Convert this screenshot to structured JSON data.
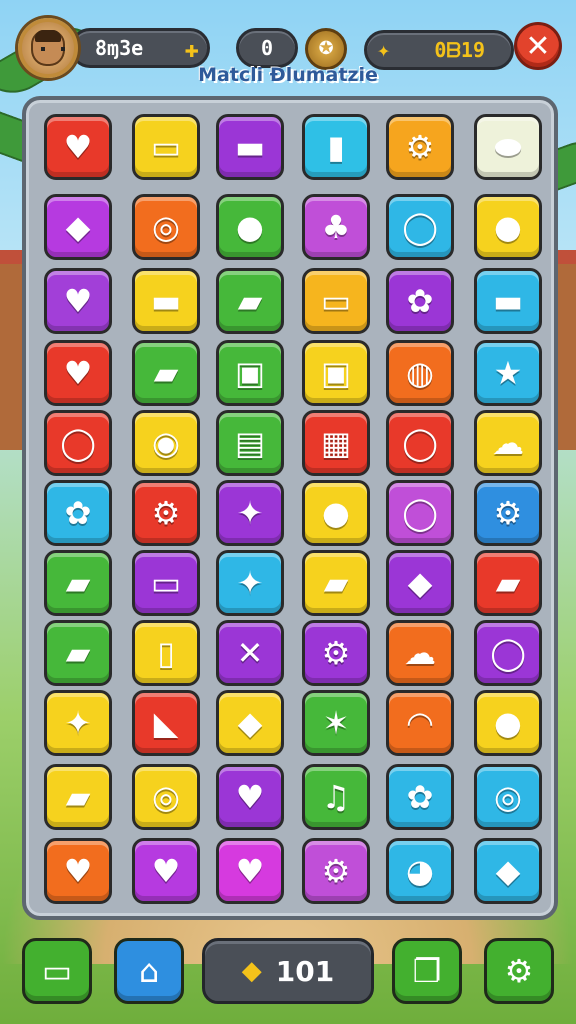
{
  "hud": {
    "player_name": "8ɱ3e",
    "plus_icon": "plus-icon",
    "score": "0",
    "coin_icon": "coin-icon",
    "best_score": "0ᗷ19",
    "medal_icon": "medal-icon",
    "close_icon": "close-icon",
    "title": "Matcli Ɖlumatzie"
  },
  "board": {
    "columns": 6,
    "rows": 11,
    "tiles": [
      {
        "color": "#e8392a",
        "sym": "♥",
        "icon": "heart-icon"
      },
      {
        "color": "#f6d21e",
        "sym": "▭",
        "icon": "card-icon"
      },
      {
        "color": "#9b36d6",
        "sym": "▬",
        "icon": "bar-icon"
      },
      {
        "color": "#2fc0e6",
        "sym": "▮",
        "icon": "capsule-icon"
      },
      {
        "color": "#f6a51e",
        "sym": "⚙",
        "icon": "gear-icon"
      },
      {
        "color": "#eef2da",
        "sym": "⬬",
        "icon": "leaf-icon"
      },
      {
        "color": "#b63ae0",
        "sym": "◆",
        "icon": "tag-icon"
      },
      {
        "color": "#f26d1e",
        "sym": "◎",
        "icon": "ring-icon"
      },
      {
        "color": "#46b83a",
        "sym": "●",
        "icon": "bulb-icon"
      },
      {
        "color": "#c04fd8",
        "sym": "♣",
        "icon": "clover-icon"
      },
      {
        "color": "#2fb7e6",
        "sym": "◯",
        "icon": "magnifier-icon"
      },
      {
        "color": "#f6d21e",
        "sym": "●",
        "icon": "fruit-icon"
      },
      {
        "color": "#a23fd8",
        "sym": "♥",
        "icon": "heart-icon"
      },
      {
        "color": "#f6d21e",
        "sym": "▬",
        "icon": "bar-icon"
      },
      {
        "color": "#46b83a",
        "sym": "▰",
        "icon": "crayon-icon"
      },
      {
        "color": "#f6b51e",
        "sym": "▭",
        "icon": "folder-icon"
      },
      {
        "color": "#9b36d6",
        "sym": "✿",
        "icon": "flower-icon"
      },
      {
        "color": "#2fb7e6",
        "sym": "▬",
        "icon": "pill-icon"
      },
      {
        "color": "#e8392a",
        "sym": "♥",
        "icon": "heart-icon"
      },
      {
        "color": "#46b83a",
        "sym": "▰",
        "icon": "pencil-icon"
      },
      {
        "color": "#46b83a",
        "sym": "▣",
        "icon": "case-icon"
      },
      {
        "color": "#f6d21e",
        "sym": "▣",
        "icon": "battery-icon"
      },
      {
        "color": "#f26d1e",
        "sym": "◍",
        "icon": "ball-icon"
      },
      {
        "color": "#2fb7e6",
        "sym": "★",
        "icon": "star-icon"
      },
      {
        "color": "#e8392a",
        "sym": "◯",
        "icon": "magnifier-icon"
      },
      {
        "color": "#f6d21e",
        "sym": "◉",
        "icon": "coin-icon"
      },
      {
        "color": "#46b83a",
        "sym": "▤",
        "icon": "keyboard-icon"
      },
      {
        "color": "#e8392a",
        "sym": "▦",
        "icon": "radio-icon"
      },
      {
        "color": "#e8392a",
        "sym": "◯",
        "icon": "magnifier-icon"
      },
      {
        "color": "#f6d21e",
        "sym": "☁",
        "icon": "slime-icon"
      },
      {
        "color": "#2fb7e6",
        "sym": "✿",
        "icon": "flower-icon"
      },
      {
        "color": "#e8392a",
        "sym": "⚙",
        "icon": "gear-icon"
      },
      {
        "color": "#9b36d6",
        "sym": "✦",
        "icon": "spinner-icon"
      },
      {
        "color": "#f6d21e",
        "sym": "●",
        "icon": "fruit-icon"
      },
      {
        "color": "#c04fd8",
        "sym": "◯",
        "icon": "ring-icon"
      },
      {
        "color": "#2f8fe0",
        "sym": "⚙",
        "icon": "gear-icon"
      },
      {
        "color": "#46b83a",
        "sym": "▰",
        "icon": "tube-icon"
      },
      {
        "color": "#9b36d6",
        "sym": "▭",
        "icon": "ticket-icon"
      },
      {
        "color": "#2fb7e6",
        "sym": "✦",
        "icon": "candy-icon"
      },
      {
        "color": "#f6d21e",
        "sym": "▰",
        "icon": "brush-icon"
      },
      {
        "color": "#9b36d6",
        "sym": "◆",
        "icon": "block-icon"
      },
      {
        "color": "#e8392a",
        "sym": "▰",
        "icon": "marker-icon"
      },
      {
        "color": "#46b83a",
        "sym": "▰",
        "icon": "crayon-icon"
      },
      {
        "color": "#f6d21e",
        "sym": "▯",
        "icon": "stick-icon"
      },
      {
        "color": "#9b36d6",
        "sym": "✕",
        "icon": "scissors-icon"
      },
      {
        "color": "#9b36d6",
        "sym": "⚙",
        "icon": "gear-icon"
      },
      {
        "color": "#f26d1e",
        "sym": "☁",
        "icon": "cloud-icon"
      },
      {
        "color": "#9b36d6",
        "sym": "◯",
        "icon": "chat-icon"
      },
      {
        "color": "#f6d21e",
        "sym": "✦",
        "icon": "rocket-icon"
      },
      {
        "color": "#e8392a",
        "sym": "◣",
        "icon": "horn-icon"
      },
      {
        "color": "#f6d21e",
        "sym": "◆",
        "icon": "gem-icon"
      },
      {
        "color": "#46b83a",
        "sym": "✶",
        "icon": "card-icon"
      },
      {
        "color": "#f26d1e",
        "sym": "◠",
        "icon": "phone-icon"
      },
      {
        "color": "#f6d21e",
        "sym": "●",
        "icon": "fruit-icon"
      },
      {
        "color": "#f6d21e",
        "sym": "▰",
        "icon": "crayon-icon"
      },
      {
        "color": "#f6d21e",
        "sym": "◎",
        "icon": "target-icon"
      },
      {
        "color": "#9b36d6",
        "sym": "♥",
        "icon": "heart-icon"
      },
      {
        "color": "#46b83a",
        "sym": "♫",
        "icon": "music-icon"
      },
      {
        "color": "#2fb7e6",
        "sym": "✿",
        "icon": "flower-icon"
      },
      {
        "color": "#2fb7e6",
        "sym": "◎",
        "icon": "ring-icon"
      },
      {
        "color": "#f26d1e",
        "sym": "♥",
        "icon": "heart-icon"
      },
      {
        "color": "#b63ae0",
        "sym": "♥",
        "icon": "heart-icon"
      },
      {
        "color": "#d63adf",
        "sym": "♥",
        "icon": "heart-icon"
      },
      {
        "color": "#c04fd8",
        "sym": "⚙",
        "icon": "gear-icon"
      },
      {
        "color": "#2fb7e6",
        "sym": "◕",
        "icon": "palette-icon"
      },
      {
        "color": "#2fb7e6",
        "sym": "◆",
        "icon": "diamond-icon"
      }
    ]
  },
  "bottom": {
    "coins": "101",
    "buttons": [
      {
        "name": "folder-button",
        "icon": "folder-icon",
        "sym": "▭",
        "style": "green"
      },
      {
        "name": "home-button",
        "icon": "home-icon",
        "sym": "⌂",
        "style": "blue"
      },
      {
        "name": "cards-button",
        "icon": "cards-icon",
        "sym": "❐",
        "style": "green"
      },
      {
        "name": "settings-button",
        "icon": "gear-icon",
        "sym": "⚙",
        "style": "green"
      }
    ]
  }
}
